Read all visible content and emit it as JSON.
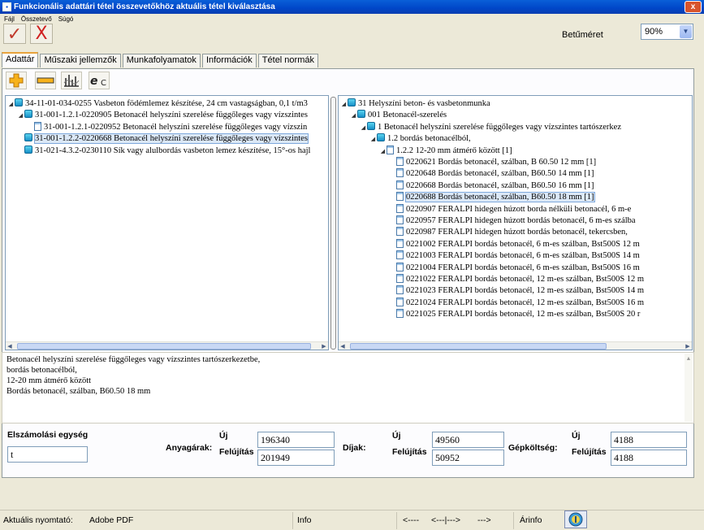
{
  "window": {
    "title": "Funkcionális adattári tétel összevetőkhöz aktuális tétel kiválasztása",
    "close": "x"
  },
  "menu": [
    "Fájl",
    "Összetevő",
    "Súgó"
  ],
  "toolbar": {
    "ok_glyph": "✓",
    "cancel_glyph": "X",
    "font_size_label": "Betűméret",
    "font_size_value": "90%"
  },
  "tabs": [
    "Adattár",
    "Műszaki jellemzők",
    "Munkafolyamatok",
    "Információk",
    "Tétel normák"
  ],
  "icons": {
    "small_toolbar": [
      "add-icon",
      "minus-icon",
      "chart-icon",
      "ec-icon"
    ],
    "tree_folder": "folder-icon",
    "tree_doc": "document-icon",
    "arinfo": "info-icon"
  },
  "left_tree": [
    {
      "label": "34-11-01-034-0255 Vasbeton födémlemez készítése, 24 cm vastagságban, 0,1 t/m3",
      "level": 0,
      "icon": "folder",
      "expanded": true
    },
    {
      "label": "31-001-1.2.1-0220905 Betonacél helyszíni szerelése  függőleges vagy vízszintes",
      "level": 1,
      "icon": "folder",
      "expanded": true
    },
    {
      "label": "31-001-1.2.1-0220952 Betonacél helyszíni szerelése  függőleges vagy vízszin",
      "level": 2,
      "icon": "doc"
    },
    {
      "label": "31-001-1.2.2-0220668 Betonacél helyszíni szerelése  függőleges vagy vízszintes",
      "level": 1,
      "icon": "folder",
      "selected": true
    },
    {
      "label": "31-021-4.3.2-0230110 Sík vagy alulbordás vasbeton lemez készítése, 15°-os hajl",
      "level": 1,
      "icon": "folder"
    }
  ],
  "right_tree": [
    {
      "label": "31 Helyszíni beton- és vasbetonmunka",
      "level": 0,
      "icon": "folder",
      "expanded": true
    },
    {
      "label": "001 Betonacél-szerelés",
      "level": 1,
      "icon": "folder",
      "expanded": true
    },
    {
      "label": "1 Betonacél helyszíni szerelése  függőleges vagy vízszintes tartószerkez",
      "level": 2,
      "icon": "folder",
      "expanded": true
    },
    {
      "label": "1.2 bordás betonacélból,",
      "level": 3,
      "icon": "folder",
      "expanded": true
    },
    {
      "label": "1.2.2 12-20 mm átmérő között [1]",
      "level": 4,
      "icon": "doc",
      "expanded": true
    },
    {
      "label": "0220621 Bordás betonacél, szálban, B 60.50  12 mm [1]",
      "level": 5,
      "icon": "doc"
    },
    {
      "label": "0220648 Bordás betonacél, szálban, B60.50  14 mm [1]",
      "level": 5,
      "icon": "doc"
    },
    {
      "label": "0220668 Bordás betonacél, szálban, B60.50  16 mm [1]",
      "level": 5,
      "icon": "doc"
    },
    {
      "label": "0220688 Bordás betonacél, szálban, B60.50  18 mm [1]",
      "level": 5,
      "icon": "doc",
      "selected": true
    },
    {
      "label": "0220907 FERALPI hidegen húzott borda nélküli betonacél, 6 m-e",
      "level": 5,
      "icon": "doc"
    },
    {
      "label": "0220957 FERALPI hidegen húzott bordás betonacél, 6 m-es szálba",
      "level": 5,
      "icon": "doc"
    },
    {
      "label": "0220987 FERALPI hidegen húzott bordás betonacél, tekercsben,",
      "level": 5,
      "icon": "doc"
    },
    {
      "label": "0221002 FERALPI bordás betonacél, 6 m-es szálban, Bst500S  12 m",
      "level": 5,
      "icon": "doc"
    },
    {
      "label": "0221003 FERALPI bordás betonacél, 6 m-es szálban, Bst500S  14 m",
      "level": 5,
      "icon": "doc"
    },
    {
      "label": "0221004 FERALPI bordás betonacél, 6 m-es szálban, Bst500S  16 m",
      "level": 5,
      "icon": "doc"
    },
    {
      "label": "0221022 FERALPI bordás betonacél, 12 m-es szálban, Bst500S  12 m",
      "level": 5,
      "icon": "doc"
    },
    {
      "label": "0221023 FERALPI bordás betonacél, 12 m-es szálban, Bst500S  14 m",
      "level": 5,
      "icon": "doc"
    },
    {
      "label": "0221024 FERALPI bordás betonacél, 12 m-es szálban, Bst500S  16 m",
      "level": 5,
      "icon": "doc"
    },
    {
      "label": "0221025 FERALPI bordás betonacél, 12 m-es szálban, Bst500S  20 r",
      "level": 5,
      "icon": "doc"
    }
  ],
  "description": [
    "Betonacél helyszíni szerelése  függőleges vagy vízszintes tartószerkezetbe,",
    "bordás betonacélból,",
    "12-20 mm átmérő között",
    "Bordás betonacél, szálban, B60.50  18 mm"
  ],
  "accounting": {
    "unit_label": "Elszámolási egység",
    "unit_value": "t",
    "new_label": "Új",
    "renew_label": "Felújítás",
    "material_label": "Anyagárak:",
    "material_new": "196340",
    "material_renew": "201949",
    "fee_label": "Díjak:",
    "fee_new": "49560",
    "fee_renew": "50952",
    "machine_label": "Gépköltség:",
    "machine_new": "4188",
    "machine_renew": "4188"
  },
  "statusbar": {
    "printer_label": "Aktuális nyomtató:",
    "printer_value": "Adobe PDF",
    "info": "Info",
    "nav_prev": "<----",
    "nav_both": "<---|--->",
    "nav_next": "--->",
    "arinfo": "Árinfo"
  }
}
